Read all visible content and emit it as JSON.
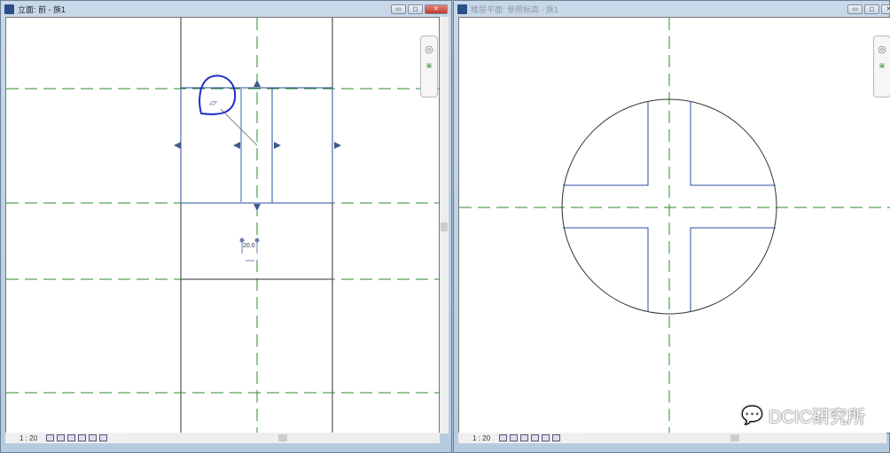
{
  "left_window": {
    "title": "立面: 前 - 族1",
    "scale": "1 : 20",
    "dimension": "20.0"
  },
  "right_window": {
    "title": "楼层平面: 参照标高 - 族1",
    "scale": "1 : 20"
  },
  "window_buttons": {
    "minimize": "▭",
    "restore": "◻",
    "close": "✕"
  },
  "watermark": "DCIC研究所",
  "colors": {
    "grid_line": "#2e8b2e",
    "sketch_line": "#2b4ea0",
    "highlight": "#1f2ec8"
  }
}
